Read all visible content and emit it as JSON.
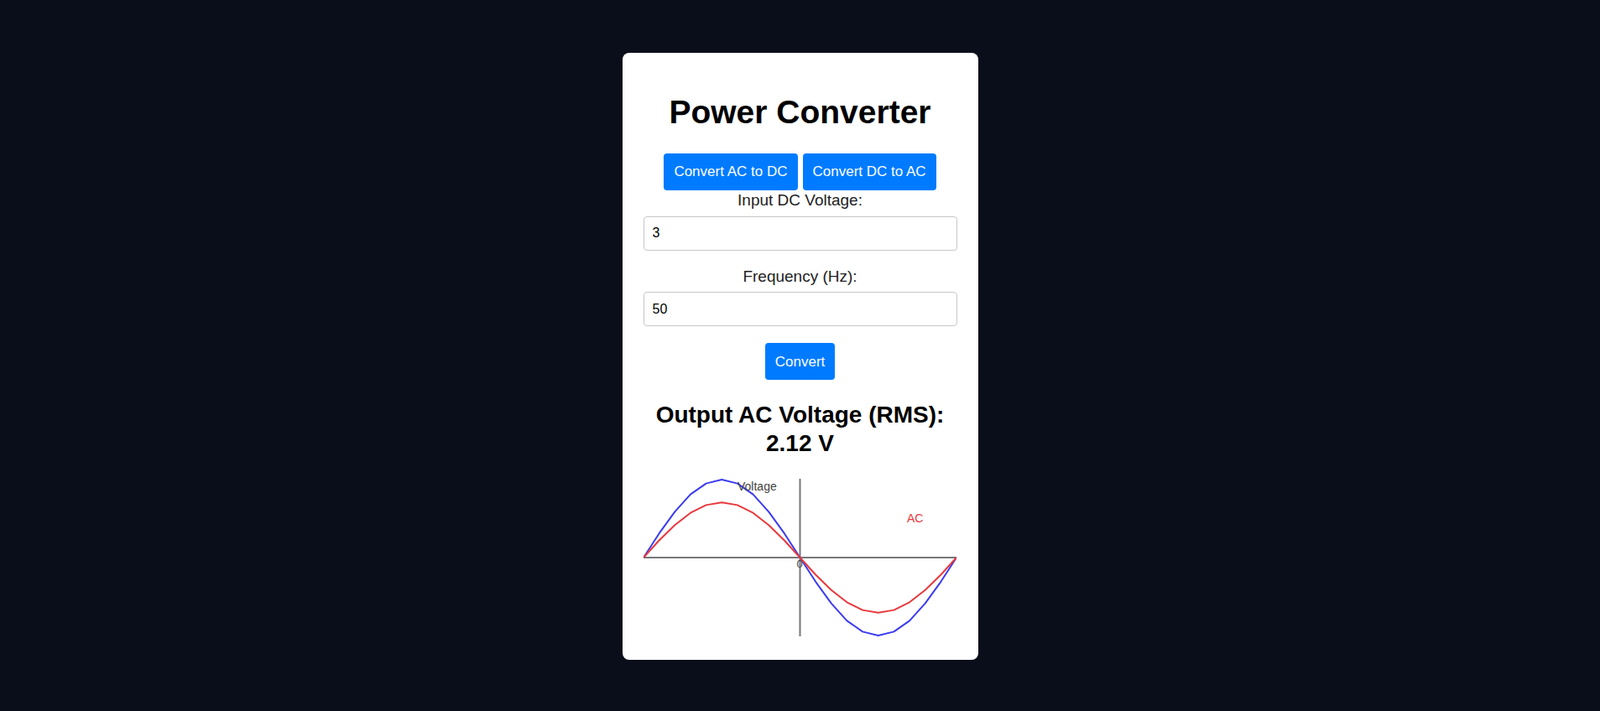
{
  "title": "Power Converter",
  "mode_buttons": [
    "Convert AC to DC",
    "Convert DC to AC"
  ],
  "fields": [
    {
      "label": "Input DC Voltage:",
      "value": "3"
    },
    {
      "label": "Frequency (Hz):",
      "value": "50"
    }
  ],
  "convert_button": "Convert",
  "output": {
    "label": "Output AC Voltage (RMS):",
    "value": "2.12 V"
  },
  "chart": {
    "y_axis_label": "Voltage",
    "origin_label": "0",
    "series": [
      {
        "color": "#3b3bf0",
        "values": [
          0,
          0.93,
          1.76,
          2.43,
          2.85,
          3,
          2.85,
          2.43,
          1.76,
          0.93,
          0,
          -0.93,
          -1.76,
          -2.43,
          -2.85,
          -3,
          -2.85,
          -2.43,
          -1.76,
          -0.93,
          0
        ]
      },
      {
        "label": "AC",
        "color": "#e8383d",
        "values": [
          0,
          0.66,
          1.25,
          1.72,
          2.02,
          2.12,
          2.02,
          1.72,
          1.25,
          0.66,
          0,
          -0.66,
          -1.25,
          -1.72,
          -2.02,
          -2.12,
          -2.02,
          -1.72,
          -1.25,
          -0.66,
          0
        ]
      }
    ]
  }
}
